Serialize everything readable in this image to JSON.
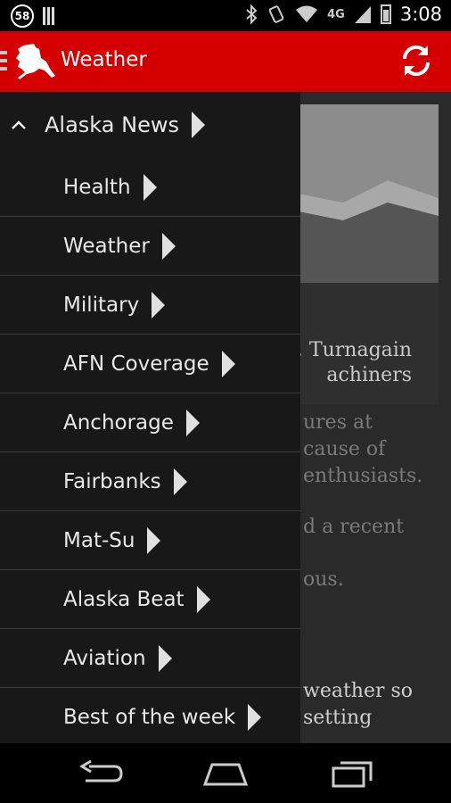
{
  "status_bar": {
    "notification_count": "58",
    "network": "4G",
    "time": "3:08",
    "icons": [
      "notification-badge",
      "barcode-icon",
      "bluetooth-icon",
      "vibrate-icon",
      "wifi-icon",
      "signal-icon",
      "battery-icon"
    ]
  },
  "action_bar": {
    "title": "Weather",
    "color": "#d40000",
    "icons": [
      "drawer-icon",
      "alaska-logo-icon",
      "refresh-icon"
    ]
  },
  "drawer": {
    "group_label": "Alaska News",
    "items": [
      {
        "label": "Health"
      },
      {
        "label": "Weather"
      },
      {
        "label": "Military"
      },
      {
        "label": "AFN Coverage"
      },
      {
        "label": "Anchorage"
      },
      {
        "label": "Fairbanks"
      },
      {
        "label": "Mat-Su"
      },
      {
        "label": "Alaska Beat"
      },
      {
        "label": "Aviation"
      },
      {
        "label": "Best of the week"
      }
    ]
  },
  "article": {
    "caption_lines": [
      ", Turnagain",
      "achiners"
    ],
    "text_lines": [
      "ures at",
      "cause of",
      "enthusiasts.",
      "d a recent",
      "ous.",
      "weather so",
      "setting"
    ]
  },
  "nav_bar": {
    "icons": [
      "back-icon",
      "home-icon",
      "recent-apps-icon"
    ]
  }
}
